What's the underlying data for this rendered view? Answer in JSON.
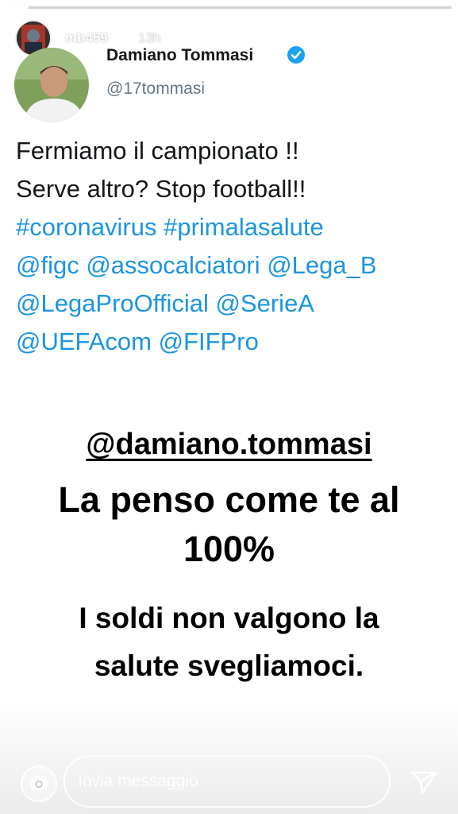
{
  "story": {
    "username": "mb459",
    "time": "13h",
    "progress": 0.05,
    "icons": {
      "close": "close-icon",
      "camera": "camera-icon",
      "send": "send-icon",
      "verified": "verified-badge-icon"
    }
  },
  "tweet": {
    "name": "Damiano Tommasi",
    "handle": "@17tommasi",
    "lines": [
      "Fermiamo il campionato !!",
      "Serve altro? Stop football!!"
    ],
    "hashtags": "#coronavirus #primalasalute",
    "mentions_1": "@figc @assocalciatori @Lega_B",
    "mentions_2": "@LegaProOfficial @SerieA",
    "mentions_3": "@UEFAcom @FIFPro"
  },
  "overlay": {
    "mention": "@damiano.tommasi",
    "big_line_1": "La penso come te al",
    "big_line_2": "100%",
    "small_line_1": "I soldi non valgono la",
    "small_line_2": "salute svegliamoci."
  },
  "reply": {
    "placeholder": "Invia messaggio"
  },
  "colors": {
    "tweet_link": "#1b95e0",
    "verified": "#1da1f2",
    "text": "#14171a",
    "handle": "#657786"
  }
}
